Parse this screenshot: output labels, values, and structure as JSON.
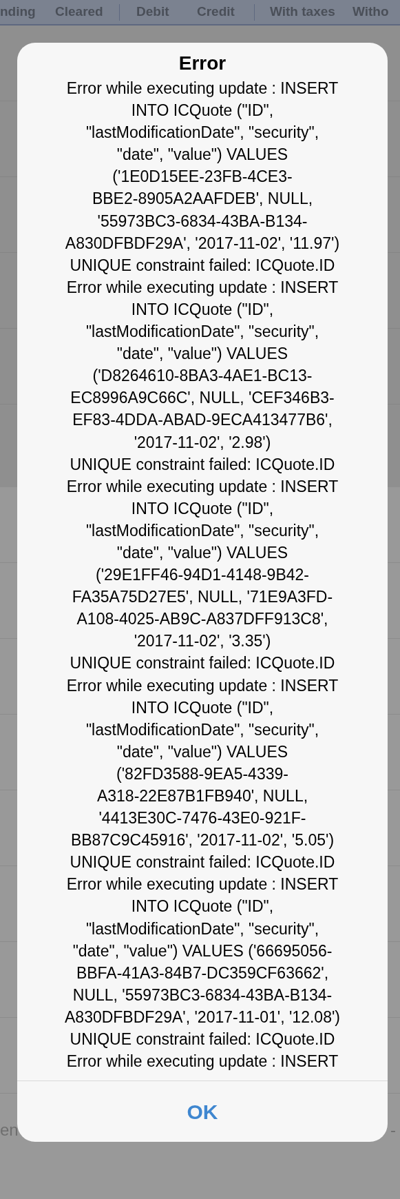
{
  "table_header": {
    "columns": [
      "nding",
      "Cleared",
      "Debit",
      "Credit",
      "With taxes",
      "Witho"
    ]
  },
  "background_row": {
    "left": "en",
    "right": "-"
  },
  "alert": {
    "title": "Error",
    "message": "Error while executing update : INSERT\nINTO ICQuote (\"ID\",\n\"lastModificationDate\", \"security\",\n\"date\", \"value\") VALUES\n('1E0D15EE-23FB-4CE3-\nBBE2-8905A2AAFDEB', NULL,\n'55973BC3-6834-43BA-B134-\nA830DFBDF29A', '2017-11-02', '11.97')\nUNIQUE constraint failed: ICQuote.ID\nError while executing update : INSERT\nINTO ICQuote (\"ID\",\n\"lastModificationDate\", \"security\",\n\"date\", \"value\") VALUES\n('D8264610-8BA3-4AE1-BC13-\nEC8996A9C66C', NULL, 'CEF346B3-\nEF83-4DDA-ABAD-9ECA413477B6',\n'2017-11-02', '2.98')\nUNIQUE constraint failed: ICQuote.ID\nError while executing update : INSERT\nINTO ICQuote (\"ID\",\n\"lastModificationDate\", \"security\",\n\"date\", \"value\") VALUES\n('29E1FF46-94D1-4148-9B42-\nFA35A75D27E5', NULL, '71E9A3FD-\nA108-4025-AB9C-A837DFF913C8',\n'2017-11-02', '3.35')\nUNIQUE constraint failed: ICQuote.ID\nError while executing update : INSERT\nINTO ICQuote (\"ID\",\n\"lastModificationDate\", \"security\",\n\"date\", \"value\") VALUES\n('82FD3588-9EA5-4339-\nA318-22E87B1FB940', NULL,\n'4413E30C-7476-43E0-921F-\nBB87C9C45916', '2017-11-02', '5.05')\nUNIQUE constraint failed: ICQuote.ID\nError while executing update : INSERT\nINTO ICQuote (\"ID\",\n\"lastModificationDate\", \"security\",\n\"date\", \"value\") VALUES ('66695056-\nBBFA-41A3-84B7-DC359CF63662',\nNULL, '55973BC3-6834-43BA-B134-\nA830DFBDF29A', '2017-11-01', '12.08')\nUNIQUE constraint failed: ICQuote.ID\nError while executing update : INSERT",
    "buttons": [
      "OK"
    ]
  }
}
